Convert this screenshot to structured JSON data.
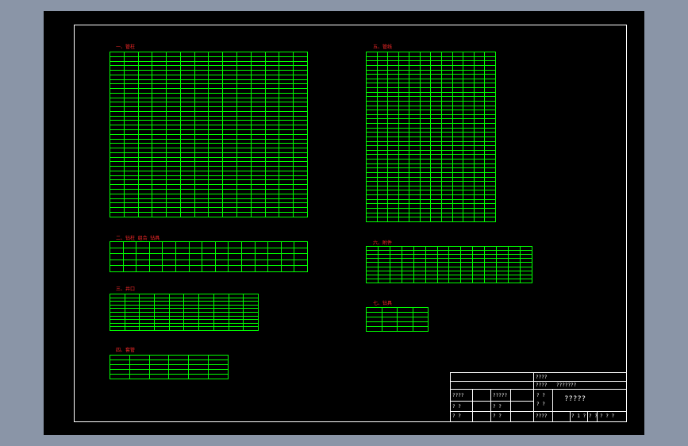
{
  "drawing": {
    "headings": {
      "h1": "一、管柱",
      "h2": "二、钻柱 组合 钻具",
      "h3": "三、井口",
      "h4": "四、套管",
      "h5": "五、管线",
      "h6": "六、附件",
      "h7": "七、钻具"
    }
  },
  "title_block": {
    "cells": {
      "r1a": "????",
      "r2a": "????",
      "r2b": "???????",
      "r3a": "????",
      "r3b": "?????",
      "r3c": "? ?",
      "r4a": "? ?",
      "r4b": "? ?",
      "r4c": "? ?",
      "r5a": "? ?",
      "r5b": "? ?",
      "r5c": "????",
      "r5d": "? 1 ?",
      "r5e": "? ?",
      "r5f": "? ? ?",
      "title": "?????"
    }
  }
}
